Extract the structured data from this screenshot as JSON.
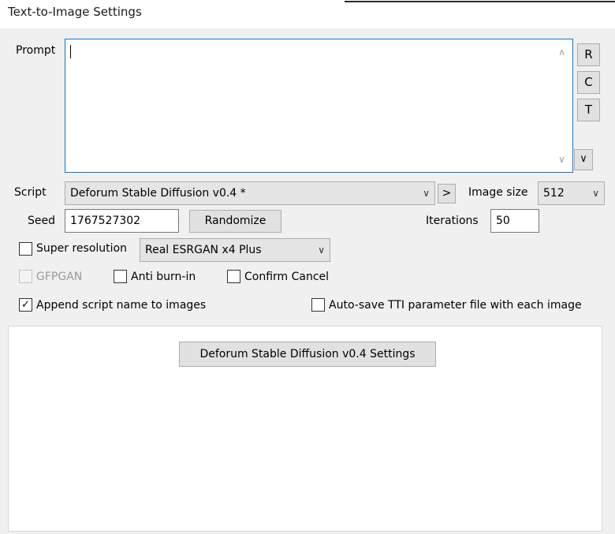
{
  "window": {
    "title": "Text-to-Image Settings"
  },
  "prompt": {
    "label": "Prompt",
    "value": "",
    "side_buttons": [
      "R",
      "C",
      "T"
    ],
    "expand_icon": "chevron-down-icon"
  },
  "script": {
    "label": "Script",
    "selected": "Deforum Stable Diffusion v0.4 *",
    "next_button": ">"
  },
  "image_size": {
    "label": "Image size",
    "selected": "512"
  },
  "seed": {
    "label": "Seed",
    "value": "1767527302",
    "randomize_label": "Randomize"
  },
  "iterations": {
    "label": "Iterations",
    "value": "50"
  },
  "super_resolution": {
    "label": "Super resolution",
    "checked": false,
    "model": "Real ESRGAN x4 Plus"
  },
  "gfpgan": {
    "label": "GFPGAN",
    "checked": false,
    "enabled": false
  },
  "anti_burn_in": {
    "label": "Anti burn-in",
    "checked": false
  },
  "confirm_cancel": {
    "label": "Confirm Cancel",
    "checked": false
  },
  "append_script_name": {
    "label": "Append script name to images",
    "checked": true
  },
  "auto_save": {
    "label": "Auto-save TTI parameter file with each image",
    "checked": false
  },
  "script_settings_button": {
    "label": "Deforum Stable Diffusion v0.4 Settings"
  },
  "glyphs": {
    "check": "✓",
    "chevron_down": "⌵",
    "scroll_up": "▲",
    "scroll_down": "▼"
  }
}
